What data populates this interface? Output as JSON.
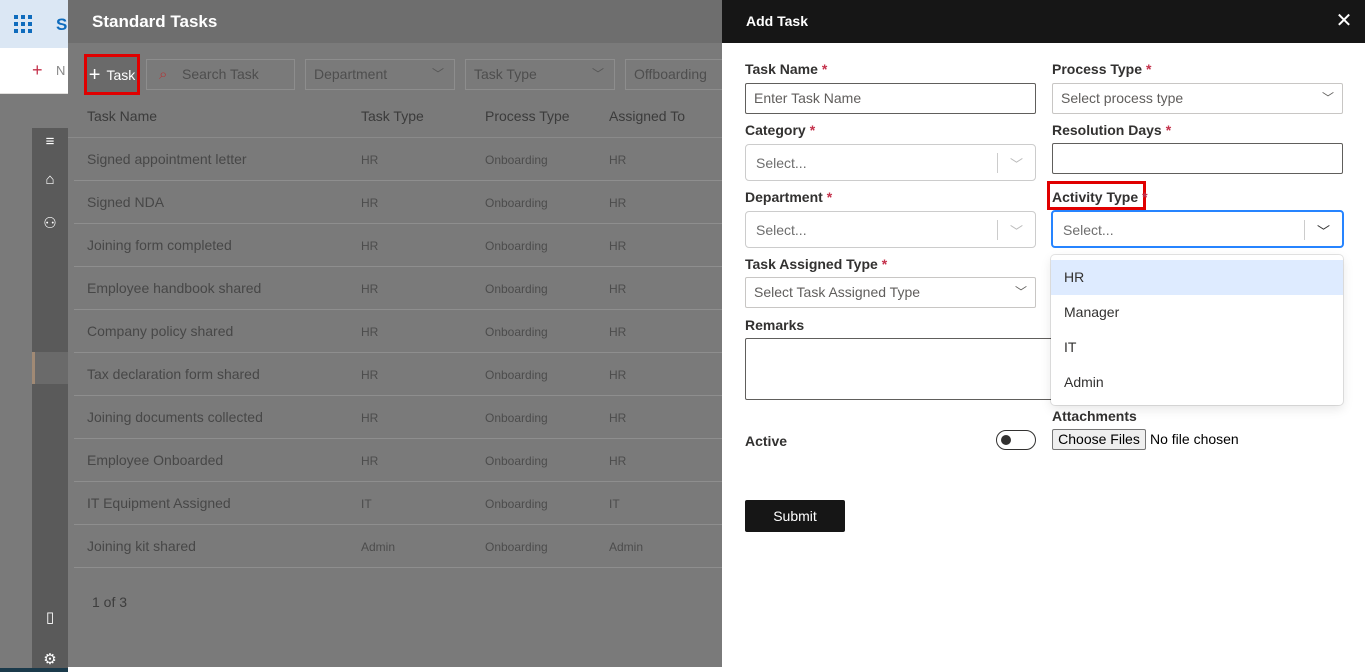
{
  "background": {
    "brand": "S",
    "new_label": "N"
  },
  "tasks_panel": {
    "title": "Standard Tasks",
    "add_task_label": "Task",
    "search_placeholder": "Search Task Name",
    "department_placeholder": "Department",
    "task_type_placeholder": "Task Type",
    "process_filter_value": "Offboarding",
    "columns": [
      "Task Name",
      "Task Type",
      "Process Type",
      "Assigned To"
    ],
    "rows": [
      {
        "name": "Signed appointment letter",
        "type": "HR",
        "process": "Onboarding",
        "assigned": "HR"
      },
      {
        "name": "Signed NDA",
        "type": "HR",
        "process": "Onboarding",
        "assigned": "HR"
      },
      {
        "name": "Joining form completed",
        "type": "HR",
        "process": "Onboarding",
        "assigned": "HR"
      },
      {
        "name": "Employee handbook shared",
        "type": "HR",
        "process": "Onboarding",
        "assigned": "HR"
      },
      {
        "name": "Company policy shared",
        "type": "HR",
        "process": "Onboarding",
        "assigned": "HR"
      },
      {
        "name": "Tax declaration form shared",
        "type": "HR",
        "process": "Onboarding",
        "assigned": "HR"
      },
      {
        "name": "Joining documents collected",
        "type": "HR",
        "process": "Onboarding",
        "assigned": "HR"
      },
      {
        "name": "Employee Onboarded",
        "type": "HR",
        "process": "Onboarding",
        "assigned": "HR"
      },
      {
        "name": "IT Equipment Assigned",
        "type": "IT",
        "process": "Onboarding",
        "assigned": "IT"
      },
      {
        "name": "Joining kit shared",
        "type": "Admin",
        "process": "Onboarding",
        "assigned": "Admin"
      }
    ],
    "pager": "1 of 3"
  },
  "add_task": {
    "title": "Add Task",
    "task_name_label": "Task Name",
    "task_name_placeholder": "Enter Task Name",
    "process_type_label": "Process Type",
    "process_type_placeholder": "Select process type",
    "category_label": "Category",
    "category_placeholder": "Select...",
    "resolution_days_label": "Resolution Days",
    "resolution_days_value": "",
    "department_label": "Department",
    "department_placeholder": "Select...",
    "activity_type_label": "Activity Type",
    "activity_type_placeholder": "Select...",
    "activity_type_options": [
      "HR",
      "Manager",
      "IT",
      "Admin"
    ],
    "task_assigned_type_label": "Task Assigned Type",
    "task_assigned_type_placeholder": "Select Task Assigned Type",
    "remarks_label": "Remarks",
    "attachments_label": "Attachments",
    "choose_files_label": "Choose Files",
    "file_status": "No file chosen",
    "active_label": "Active",
    "required_mark": "*",
    "submit_label": "Submit"
  }
}
